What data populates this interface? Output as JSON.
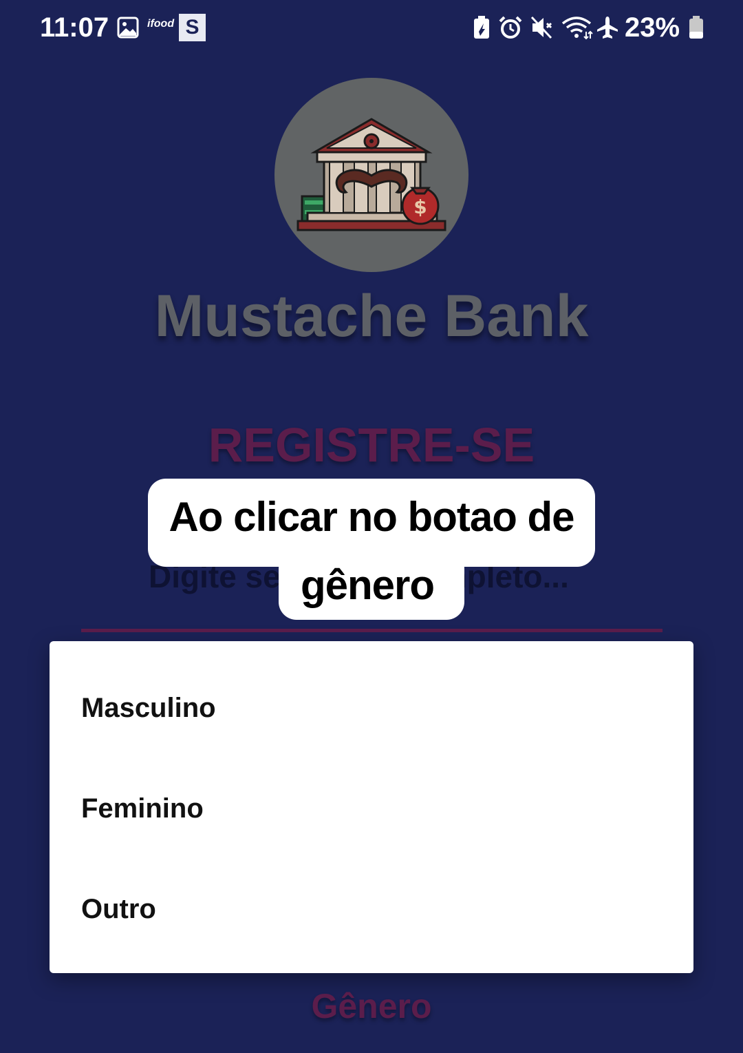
{
  "status_bar": {
    "time": "11:07",
    "ifood_label": "ifood",
    "s_badge": "S",
    "battery_percent": "23%",
    "icons": [
      "gallery-icon",
      "ifood-icon",
      "s-app-icon",
      "battery-saver-icon",
      "alarm-icon",
      "mute-icon",
      "wifi-icon",
      "airplane-icon",
      "battery-icon"
    ]
  },
  "app": {
    "title": "Mustache Bank",
    "logo_icon": "bank-mustache-logo"
  },
  "form": {
    "heading": "REGISTRE-SE",
    "name_placeholder": "Digite seu nome completo...",
    "gender_label": "Gênero"
  },
  "caption": {
    "line1": "Ao clicar no botao de",
    "line2": "gênero"
  },
  "dropdown": {
    "options": [
      "Masculino",
      "Feminino",
      "Outro"
    ]
  },
  "colors": {
    "background": "#1b2257",
    "accent": "#5b1d4b",
    "logo_circle": "#616465"
  }
}
